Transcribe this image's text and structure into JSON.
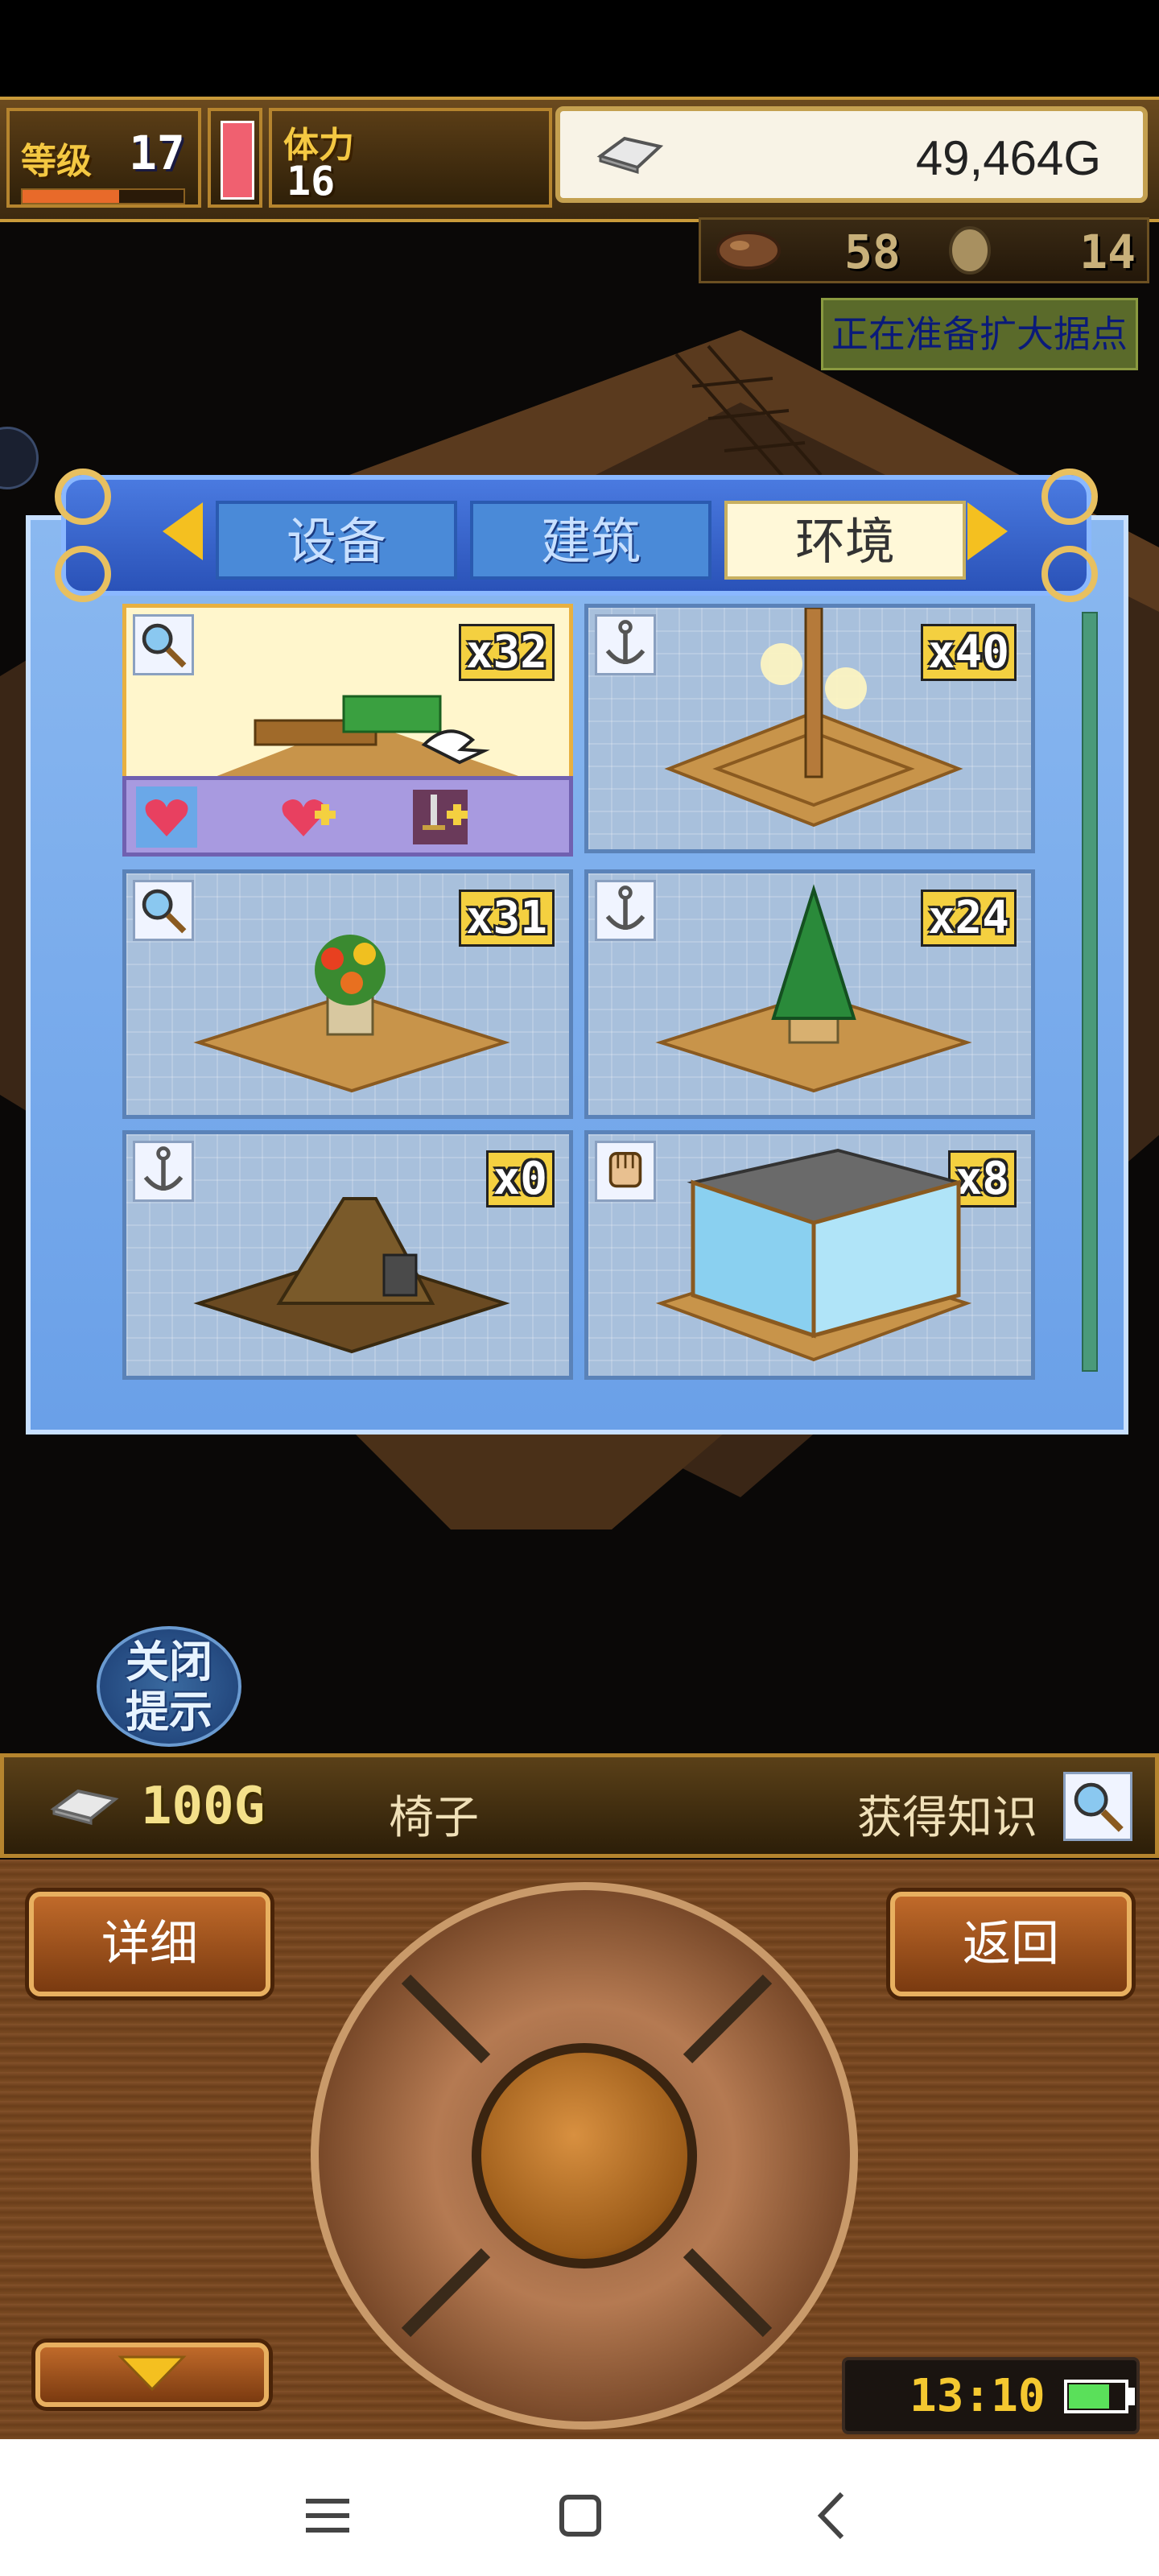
{
  "hud": {
    "level_label": "等级",
    "level_value": "17",
    "level_progress": 0.6,
    "stamina_label": "体力",
    "stamina_value": "16",
    "gold": "49,464G"
  },
  "materials": {
    "first_icon": "seed-icon",
    "first_value": "58",
    "second_icon": "egg-icon",
    "second_value": "14"
  },
  "expand_notice": "正在准备扩大据点",
  "panel": {
    "tabs": [
      {
        "label": "设备",
        "active": false
      },
      {
        "label": "建筑",
        "active": false
      },
      {
        "label": "环境",
        "active": true
      }
    ],
    "items": [
      {
        "qty": "x32",
        "badge": "magnifier-icon",
        "art": "bench-planter",
        "selected": true
      },
      {
        "qty": "x40",
        "badge": "anchor-icon",
        "art": "lamp-post"
      },
      {
        "qty": "x31",
        "badge": "magnifier-icon",
        "art": "flower-pot"
      },
      {
        "qty": "x24",
        "badge": "anchor-icon",
        "art": "pine-tree"
      },
      {
        "qty": "x0",
        "badge": "anchor-icon",
        "art": "mound"
      },
      {
        "qty": "x8",
        "badge": "fist-icon",
        "art": "aquarium"
      }
    ],
    "actions": [
      "heart-icon",
      "heart-plus-icon",
      "sword-plus-icon"
    ]
  },
  "hint_button": {
    "line1": "关闭",
    "line2": "提示"
  },
  "info": {
    "price": "100G",
    "item_name": "椅子",
    "knowledge": "获得知识"
  },
  "controls": {
    "detail": "详细",
    "back": "返回",
    "clock": "13:10",
    "battery_level": 0.7
  },
  "colors": {
    "accent_gold": "#f4c842",
    "panel_blue": "#6aa0e8",
    "wood": "#7a4a22"
  }
}
